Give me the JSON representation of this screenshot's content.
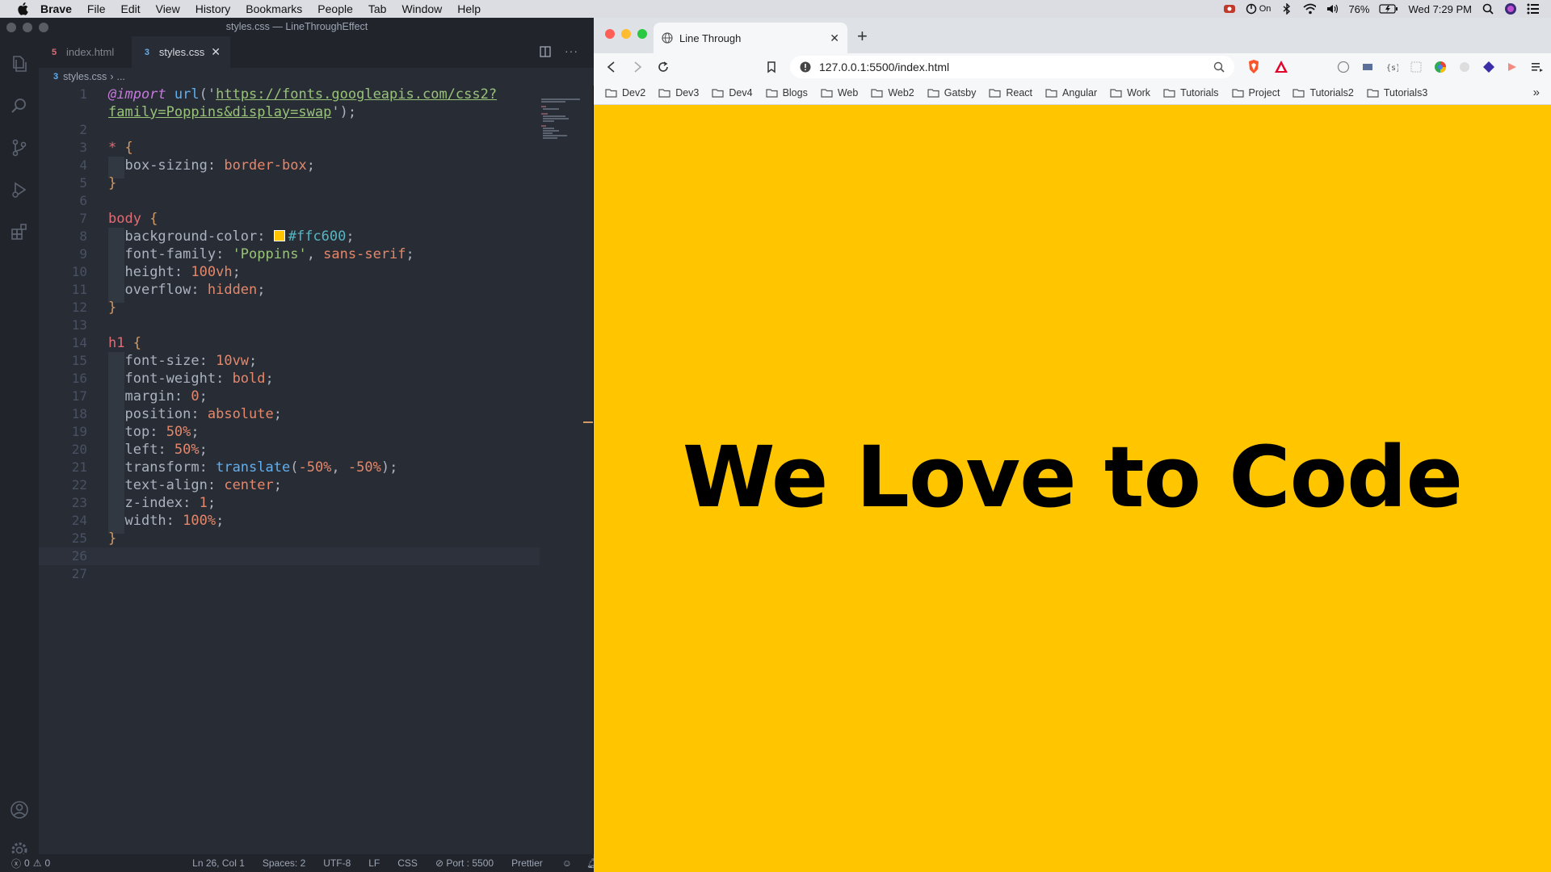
{
  "menubar": {
    "app": "Brave",
    "items": [
      "File",
      "Edit",
      "View",
      "History",
      "Bookmarks",
      "People",
      "Tab",
      "Window",
      "Help"
    ],
    "status": {
      "vpn": "On",
      "battery": "76%",
      "clock": "Wed 7:29 PM"
    }
  },
  "vscode": {
    "title": "styles.css — LineThroughEffect",
    "tabs": [
      {
        "label": "index.html",
        "active": false
      },
      {
        "label": "styles.css",
        "active": true
      }
    ],
    "breadcrumb": {
      "file": "styles.css",
      "rest": "..."
    },
    "code_lines": [
      "@import url('https://fonts.googleapis.com/css2?",
      "family=Poppins&display=swap');",
      "",
      "* {",
      "  box-sizing: border-box;",
      "}",
      "",
      "body {",
      "  background-color: #ffc600;",
      "  font-family: 'Poppins', sans-serif;",
      "  height: 100vh;",
      "  overflow: hidden;",
      "}",
      "",
      "h1 {",
      "  font-size: 10vw;",
      "  font-weight: bold;",
      "  margin: 0;",
      "  position: absolute;",
      "  top: 50%;",
      "  left: 50%;",
      "  transform: translate(-50%, -50%);",
      "  text-align: center;",
      "  z-index: 1;",
      "  width: 100%;",
      "}",
      "",
      ""
    ],
    "line_numbers": [
      "1",
      "",
      "2",
      "3",
      "4",
      "5",
      "6",
      "7",
      "8",
      "9",
      "10",
      "11",
      "12",
      "13",
      "14",
      "15",
      "16",
      "17",
      "18",
      "19",
      "20",
      "21",
      "22",
      "23",
      "24",
      "25",
      "26",
      "27"
    ],
    "status": {
      "problems": "0",
      "warnings": "0",
      "cursor": "Ln 26, Col 1",
      "spaces": "Spaces: 2",
      "encoding": "UTF-8",
      "eol": "LF",
      "language": "CSS",
      "port": "Port : 5500",
      "formatter": "Prettier"
    }
  },
  "browser": {
    "tab_title": "Line Through",
    "url": "127.0.0.1:5500/index.html",
    "bookmarks": [
      "Dev2",
      "Dev3",
      "Dev4",
      "Blogs",
      "Web",
      "Web2",
      "Gatsby",
      "React",
      "Angular",
      "Work",
      "Tutorials",
      "Project",
      "Tutorials2",
      "Tutorials3"
    ],
    "page": {
      "heading": "We Love to Code",
      "background": "#ffc600"
    }
  }
}
